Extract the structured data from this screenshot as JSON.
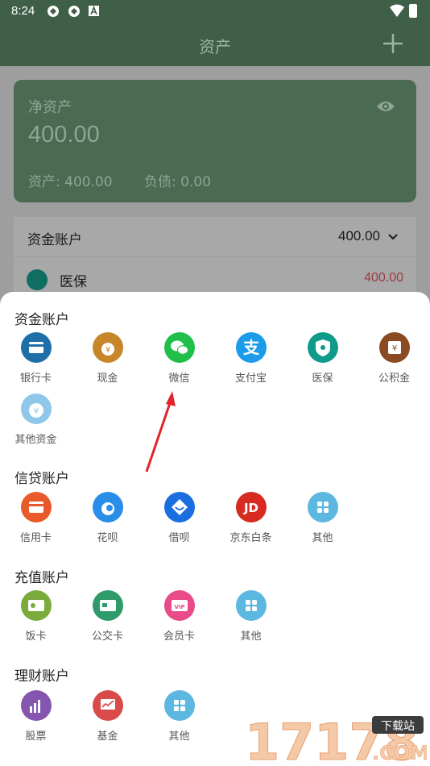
{
  "status_bar": {
    "time": "8:24"
  },
  "app_bar": {
    "title": "资产"
  },
  "net_assets": {
    "label": "净资产",
    "amount": "400.00",
    "assets": "资产: 400.00",
    "liabilities": "负债: 0.00"
  },
  "account_group": {
    "header": "资金账户",
    "total": "400.00",
    "rows": [
      {
        "name": "医保",
        "value": "400.00"
      }
    ]
  },
  "sheet": {
    "sections": [
      {
        "title": "资金账户",
        "items": [
          {
            "label": "银行卡",
            "icon": "bank-card-icon",
            "color": "#1e6fa8"
          },
          {
            "label": "现金",
            "icon": "cash-icon",
            "color": "#c8862a"
          },
          {
            "label": "微信",
            "icon": "wechat-icon",
            "color": "#1fbf4a"
          },
          {
            "label": "支付宝",
            "icon": "alipay-icon",
            "color": "#1c9bea"
          },
          {
            "label": "医保",
            "icon": "medical-insurance-icon",
            "color": "#0f9a8a"
          },
          {
            "label": "公积金",
            "icon": "housing-fund-icon",
            "color": "#8b4a22"
          },
          {
            "label": "其他资金",
            "icon": "other-fund-icon",
            "color": "#8ec7ea"
          }
        ]
      },
      {
        "title": "信贷账户",
        "items": [
          {
            "label": "信用卡",
            "icon": "credit-card-icon",
            "color": "#e95a2a"
          },
          {
            "label": "花呗",
            "icon": "huabei-icon",
            "color": "#2a8ee8"
          },
          {
            "label": "借呗",
            "icon": "jiebei-icon",
            "color": "#1a6ee0"
          },
          {
            "label": "京东白条",
            "icon": "jd-icon",
            "color": "#d72b22"
          },
          {
            "label": "其他",
            "icon": "other-grid-icon",
            "color": "#5cb8e0"
          }
        ]
      },
      {
        "title": "充值账户",
        "items": [
          {
            "label": "饭卡",
            "icon": "meal-card-icon",
            "color": "#7bab3c"
          },
          {
            "label": "公交卡",
            "icon": "bus-card-icon",
            "color": "#2f9a6a"
          },
          {
            "label": "会员卡",
            "icon": "vip-card-icon",
            "color": "#e94b8a"
          },
          {
            "label": "其他",
            "icon": "other-grid-icon",
            "color": "#5cb8e0"
          }
        ]
      },
      {
        "title": "理财账户",
        "items": [
          {
            "label": "股票",
            "icon": "stock-icon",
            "color": "#8456b0"
          },
          {
            "label": "基金",
            "icon": "fund-icon",
            "color": "#d94a4a"
          },
          {
            "label": "其他",
            "icon": "other-grid-icon",
            "color": "#5cb8e0"
          }
        ]
      }
    ]
  },
  "watermark": {
    "text": "17178",
    "sub": "下载站",
    "domain": ".COM"
  }
}
